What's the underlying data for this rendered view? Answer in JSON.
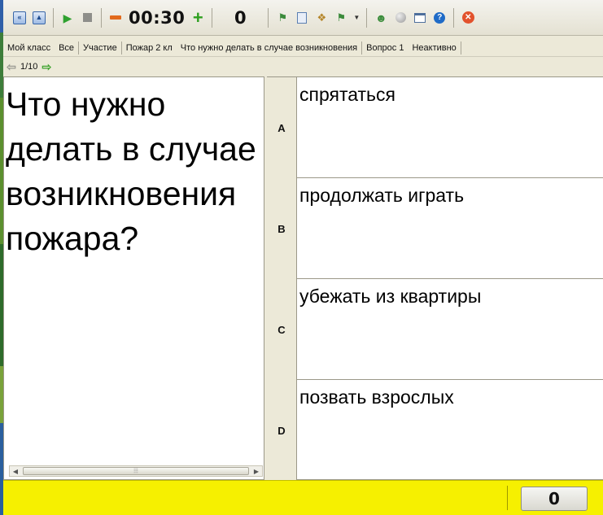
{
  "toolbar": {
    "timer": "00:30",
    "response_count": "0",
    "icons": [
      "first-icon",
      "previous-icon",
      "play-icon",
      "stop-icon",
      "minus-icon",
      "plus-icon",
      "students-icon",
      "document-icon",
      "quiz-icon",
      "sort-icon",
      "dropdown-arrow-icon",
      "person-icon",
      "globe-icon",
      "window-icon",
      "help-icon",
      "close-icon"
    ]
  },
  "infobar": {
    "class_name": "Мой класс",
    "group": "Все",
    "participation": "Участие",
    "quiz_name": "Пожар 2 кл",
    "question_title": "Что нужно делать в случае возникновения",
    "question_number": "Вопрос  1",
    "state": "Неактивно"
  },
  "navigation": {
    "position": "1/10"
  },
  "question": {
    "text": "Что нужно делать в случае возникновения пожара?"
  },
  "answers": [
    {
      "letter": "A",
      "text": "спрятаться"
    },
    {
      "letter": "B",
      "text": "продолжать играть"
    },
    {
      "letter": "C",
      "text": "убежать из квартиры"
    },
    {
      "letter": "D",
      "text": "позвать взрослых"
    }
  ],
  "status": {
    "score": "0",
    "background_color": "#f6f000"
  }
}
